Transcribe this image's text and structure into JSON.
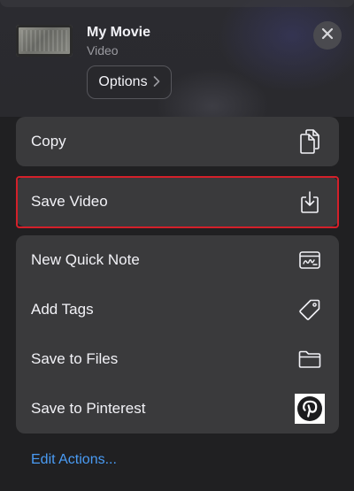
{
  "header": {
    "title": "My Movie",
    "subtitle": "Video",
    "options_label": "Options"
  },
  "actions": {
    "copy_label": "Copy",
    "save_video_label": "Save Video",
    "items": [
      {
        "label": "New Quick Note",
        "icon": "quick-note-icon"
      },
      {
        "label": "Add Tags",
        "icon": "tag-icon"
      },
      {
        "label": "Save to Files",
        "icon": "folder-icon"
      },
      {
        "label": "Save to Pinterest",
        "icon": "pinterest-icon"
      }
    ]
  },
  "footer": {
    "edit_actions_label": "Edit Actions..."
  },
  "colors": {
    "accent": "#4a9cf5",
    "highlight": "#d3202a",
    "row_background": "#3a3a3c"
  }
}
